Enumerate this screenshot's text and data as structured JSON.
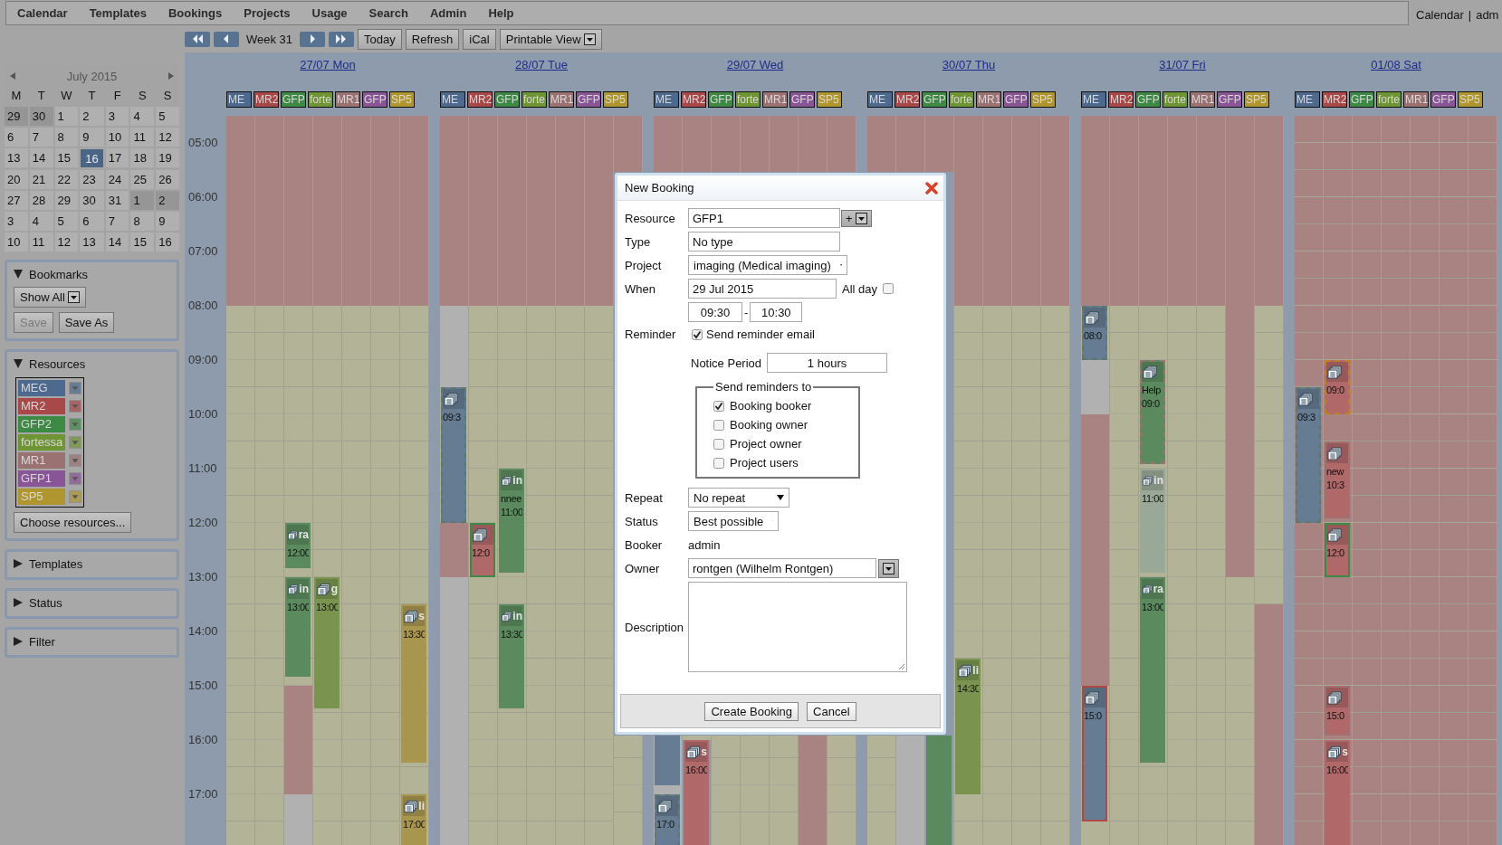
{
  "menu": [
    "Calendar",
    "Templates",
    "Bookings",
    "Projects",
    "Usage",
    "Search",
    "Admin",
    "Help"
  ],
  "user_links": [
    "Calendar",
    "|",
    "adm"
  ],
  "toolbar": {
    "week": "Week 31",
    "buttons": [
      "Today",
      "Refresh",
      "iCal"
    ],
    "view_button": "Printable View"
  },
  "mini_calendar": {
    "title": "July 2015",
    "weekdays": [
      "M",
      "T",
      "W",
      "T",
      "F",
      "S",
      "S"
    ],
    "weeks": [
      [
        {
          "day": "29",
          "muted": true,
          "selected": false
        },
        {
          "day": "30",
          "muted": true,
          "selected": false
        },
        {
          "day": "1",
          "muted": false,
          "selected": false
        },
        {
          "day": "2",
          "muted": false,
          "selected": false
        },
        {
          "day": "3",
          "muted": false,
          "selected": false
        },
        {
          "day": "4",
          "muted": false,
          "selected": false
        },
        {
          "day": "5",
          "muted": false,
          "selected": false
        }
      ],
      [
        {
          "day": "6",
          "muted": false,
          "selected": false
        },
        {
          "day": "7",
          "muted": false,
          "selected": false
        },
        {
          "day": "8",
          "muted": false,
          "selected": false
        },
        {
          "day": "9",
          "muted": false,
          "selected": false
        },
        {
          "day": "10",
          "muted": false,
          "selected": false
        },
        {
          "day": "11",
          "muted": false,
          "selected": false
        },
        {
          "day": "12",
          "muted": false,
          "selected": false
        }
      ],
      [
        {
          "day": "13",
          "muted": false,
          "selected": false
        },
        {
          "day": "14",
          "muted": false,
          "selected": false
        },
        {
          "day": "15",
          "muted": false,
          "selected": false
        },
        {
          "day": "16",
          "muted": false,
          "selected": true
        },
        {
          "day": "17",
          "muted": false,
          "selected": false
        },
        {
          "day": "18",
          "muted": false,
          "selected": false
        },
        {
          "day": "19",
          "muted": false,
          "selected": false
        }
      ],
      [
        {
          "day": "20",
          "muted": false,
          "selected": false
        },
        {
          "day": "21",
          "muted": false,
          "selected": false
        },
        {
          "day": "22",
          "muted": false,
          "selected": false
        },
        {
          "day": "23",
          "muted": false,
          "selected": false
        },
        {
          "day": "24",
          "muted": false,
          "selected": false
        },
        {
          "day": "25",
          "muted": false,
          "selected": false
        },
        {
          "day": "26",
          "muted": false,
          "selected": false
        }
      ],
      [
        {
          "day": "27",
          "muted": false,
          "selected": false
        },
        {
          "day": "28",
          "muted": false,
          "selected": false
        },
        {
          "day": "29",
          "muted": false,
          "selected": false
        },
        {
          "day": "30",
          "muted": false,
          "selected": false
        },
        {
          "day": "31",
          "muted": false,
          "selected": false
        },
        {
          "day": "1",
          "muted": true,
          "selected": false
        },
        {
          "day": "2",
          "muted": true,
          "selected": false
        }
      ],
      [
        {
          "day": "3",
          "muted": false,
          "selected": false
        },
        {
          "day": "4",
          "muted": false,
          "selected": false
        },
        {
          "day": "5",
          "muted": false,
          "selected": false
        },
        {
          "day": "6",
          "muted": false,
          "selected": false
        },
        {
          "day": "7",
          "muted": false,
          "selected": false
        },
        {
          "day": "8",
          "muted": false,
          "selected": false
        },
        {
          "day": "9",
          "muted": false,
          "selected": false
        }
      ],
      [
        {
          "day": "10",
          "muted": false,
          "selected": false
        },
        {
          "day": "11",
          "muted": false,
          "selected": false
        },
        {
          "day": "12",
          "muted": false,
          "selected": false
        },
        {
          "day": "13",
          "muted": false,
          "selected": false
        },
        {
          "day": "14",
          "muted": false,
          "selected": false
        },
        {
          "day": "15",
          "muted": false,
          "selected": false
        },
        {
          "day": "16",
          "muted": false,
          "selected": false
        }
      ]
    ]
  },
  "bookmarks": {
    "title": "Bookmarks",
    "expanded": true,
    "show_button": "Show All",
    "buttons": [
      {
        "label": "Save",
        "disabled": true
      },
      {
        "label": "Save As",
        "disabled": false
      }
    ]
  },
  "resources": {
    "title": "Resources",
    "expanded": true,
    "items": [
      {
        "label": "MEG",
        "color": "#4d6a8e"
      },
      {
        "label": "MR2",
        "color": "#a84848"
      },
      {
        "label": "GFP2",
        "color": "#3d8a45"
      },
      {
        "label": "fortessa",
        "color": "#6e9434"
      },
      {
        "label": "MR1",
        "color": "#9a7272"
      },
      {
        "label": "GFP1",
        "color": "#8a5596"
      },
      {
        "label": "SP5",
        "color": "#b0962e"
      }
    ],
    "choose_button": "Choose resources..."
  },
  "collapsed_panels": [
    {
      "title": "Templates",
      "expanded": false
    },
    {
      "title": "Status",
      "expanded": false
    },
    {
      "title": "Filter",
      "expanded": false
    }
  ],
  "hours": [
    "05:00",
    "06:00",
    "07:00",
    "08:00",
    "09:00",
    "10:00",
    "11:00",
    "12:00",
    "13:00",
    "14:00",
    "15:00",
    "16:00",
    "17:00"
  ],
  "days": [
    {
      "label": "27/07 Mon",
      "chips": [
        {
          "label": "ME",
          "color": "#4d6a8e"
        },
        {
          "label": "MR2",
          "color": "#a84848"
        },
        {
          "label": "GFP",
          "color": "#3d8a45"
        },
        {
          "label": "forte",
          "color": "#6e9434"
        },
        {
          "label": "MR1",
          "color": "#9a7272"
        },
        {
          "label": "GFP",
          "color": "#8a5596"
        },
        {
          "label": "SP5",
          "color": "#b0962e"
        }
      ],
      "bookings": [
        {
          "kind": "plain",
          "color": "#5b8a5e",
          "title": "ra",
          "time": "12:00"
        },
        {
          "kind": "plain",
          "color": "#5b8a5e",
          "title": "in",
          "time": "13:00"
        },
        {
          "kind": "plain",
          "color": "#7a9450",
          "title": "g",
          "time": "13:00"
        },
        {
          "kind": "plain",
          "color": "#a8954e",
          "title": "s",
          "time": "13:30"
        },
        {
          "kind": "plain",
          "color": "#a8954e",
          "title": "li",
          "time": "17:00"
        }
      ]
    },
    {
      "label": "28/07 Tue",
      "chips": [
        {
          "label": "ME",
          "color": "#4d6a8e"
        },
        {
          "label": "MR2",
          "color": "#a84848"
        },
        {
          "label": "GFP",
          "color": "#3d8a45"
        },
        {
          "label": "forte",
          "color": "#6e9434"
        },
        {
          "label": "MR1",
          "color": "#9a7272"
        },
        {
          "label": "GFP",
          "color": "#8a5596"
        },
        {
          "label": "SP5",
          "color": "#b0962e"
        }
      ],
      "bookings": [
        {
          "kind": "dashed",
          "color": "#667c92",
          "time": "09:3"
        },
        {
          "kind": "framed",
          "color": "#b06868",
          "time": "12:0"
        },
        {
          "kind": "plain",
          "color": "#5b8a5e",
          "title": "in",
          "note": "nnee",
          "time": "11:00"
        },
        {
          "kind": "plain",
          "color": "#5b8a5e",
          "title": "in",
          "time": "13:30"
        }
      ]
    },
    {
      "label": "29/07 Wed",
      "chips": [
        {
          "label": "ME",
          "color": "#4d6a8e"
        },
        {
          "label": "MR2",
          "color": "#a84848"
        },
        {
          "label": "GFP",
          "color": "#3d8a45"
        },
        {
          "label": "forte",
          "color": "#6e9434"
        },
        {
          "label": "MR1",
          "color": "#9a7272"
        },
        {
          "label": "GFP",
          "color": "#8a5596"
        },
        {
          "label": "SP5",
          "color": "#b0962e"
        }
      ],
      "bookings": [
        {
          "kind": "plain",
          "color": "#667c92"
        },
        {
          "kind": "dashed",
          "color": "#667c92",
          "time": "17:0"
        },
        {
          "kind": "plain",
          "color": "#b06868",
          "title": "s",
          "time": "16:00"
        }
      ]
    },
    {
      "label": "30/07 Thu",
      "chips": [
        {
          "label": "ME",
          "color": "#4d6a8e"
        },
        {
          "label": "MR2",
          "color": "#a84848"
        },
        {
          "label": "GFP",
          "color": "#3d8a45"
        },
        {
          "label": "forte",
          "color": "#6e9434"
        },
        {
          "label": "MR1",
          "color": "#9a7272"
        },
        {
          "label": "GFP",
          "color": "#8a5596"
        },
        {
          "label": "SP5",
          "color": "#b0962e"
        }
      ],
      "bookings": [
        {
          "kind": "plain",
          "color": "#5b8a5e"
        },
        {
          "kind": "plain",
          "color": "#7a9450",
          "title": "li",
          "time": "14:30"
        }
      ]
    },
    {
      "label": "31/07 Fri",
      "chips": [
        {
          "label": "ME",
          "color": "#4d6a8e"
        },
        {
          "label": "MR2",
          "color": "#a84848"
        },
        {
          "label": "GFP",
          "color": "#3d8a45"
        },
        {
          "label": "forte",
          "color": "#6e9434"
        },
        {
          "label": "MR1",
          "color": "#9a7272"
        },
        {
          "label": "GFP",
          "color": "#8a5596"
        },
        {
          "label": "SP5",
          "color": "#b0962e"
        }
      ],
      "bookings": [
        {
          "kind": "dashed",
          "color": "#667c92",
          "time": "08:0"
        },
        {
          "kind": "alert",
          "color": "#667c92",
          "time": "15:0"
        },
        {
          "kind": "marked",
          "color": "#5b8a5e",
          "note": "Help",
          "time": "09:0"
        },
        {
          "kind": "plain",
          "color": "#9aa898",
          "title": "in",
          "time": "11:00"
        },
        {
          "kind": "plain",
          "color": "#5b8a5e",
          "title": "ra",
          "time": "13:00"
        }
      ]
    },
    {
      "label": "01/08 Sat",
      "chips": [
        {
          "label": "ME",
          "color": "#4d6a8e"
        },
        {
          "label": "MR2",
          "color": "#a84848"
        },
        {
          "label": "GFP",
          "color": "#3d8a45"
        },
        {
          "label": "forte",
          "color": "#6e9434"
        },
        {
          "label": "MR1",
          "color": "#9a7272"
        },
        {
          "label": "GFP",
          "color": "#8a5596"
        },
        {
          "label": "SP5",
          "color": "#b0962e"
        }
      ],
      "bookings": [
        {
          "kind": "dashed",
          "color": "#667c92",
          "time": "09:3"
        },
        {
          "kind": "highlighted",
          "color": "#b06868",
          "time": "09:0"
        },
        {
          "kind": "marked",
          "color": "#b06868",
          "note": "new",
          "time": "10:3"
        },
        {
          "kind": "framed",
          "color": "#b06868",
          "time": "12:0"
        },
        {
          "kind": "marked",
          "color": "#b06868",
          "time": "15:0"
        },
        {
          "kind": "plain",
          "color": "#b06868",
          "title": "s",
          "time": "16:00"
        }
      ]
    }
  ],
  "dialog": {
    "title": "New Booking",
    "resource": {
      "label": "Resource",
      "value": "GFP1",
      "add": "+"
    },
    "type": {
      "label": "Type",
      "value": "No type"
    },
    "project": {
      "label": "Project",
      "value": "imaging (Medical imaging)"
    },
    "when": {
      "label": "When",
      "date": "29 Jul 2015",
      "all_day_label": "All day",
      "all_day": false,
      "start": "09:30",
      "separator": "-",
      "end": "10:30"
    },
    "reminder": {
      "label": "Reminder",
      "send_label": "Send reminder email",
      "send": true,
      "notice_label": "Notice Period",
      "notice": "1 hours",
      "recipients_title": "Send reminders to",
      "recipients": [
        {
          "label": "Booking booker",
          "checked": true
        },
        {
          "label": "Booking owner",
          "checked": false
        },
        {
          "label": "Project owner",
          "checked": false
        },
        {
          "label": "Project users",
          "checked": false
        }
      ]
    },
    "repeat": {
      "label": "Repeat",
      "value": "No repeat"
    },
    "status": {
      "label": "Status",
      "value": "Best possible"
    },
    "booker": {
      "label": "Booker",
      "value": "admin"
    },
    "owner": {
      "label": "Owner",
      "value": "rontgen (Wilhelm Rontgen)"
    },
    "description": {
      "label": "Description"
    },
    "buttons": [
      "Create Booking",
      "Cancel"
    ]
  }
}
